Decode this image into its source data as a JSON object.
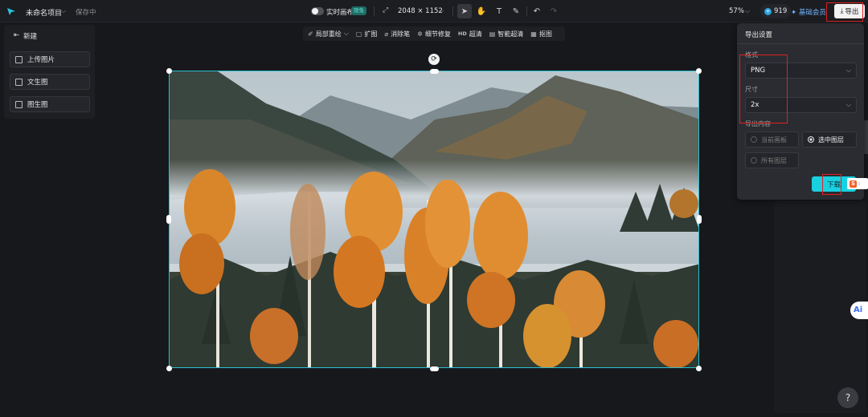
{
  "topbar": {
    "project_title": "未命名项目",
    "save_status": "保存中",
    "live_canvas_label": "实时画布",
    "live_canvas_badge": "限免",
    "canvas_size": "2048 × 1152",
    "zoom": "57%",
    "credits": "919",
    "vip_label": "基础会员",
    "export_label": "导出"
  },
  "left_panel": {
    "new_label": "新建",
    "items": [
      {
        "label": "上传图片",
        "icon": "upload-image-icon"
      },
      {
        "label": "文生图",
        "icon": "text-to-image-icon"
      },
      {
        "label": "图生图",
        "icon": "image-to-image-icon"
      }
    ]
  },
  "sub_toolbar": {
    "items": [
      {
        "label": "局部重绘",
        "glyph": "✐",
        "icon": "inpaint-icon"
      },
      {
        "label": "扩图",
        "glyph": "▢",
        "icon": "expand-icon"
      },
      {
        "label": "消除笔",
        "glyph": "⌀",
        "icon": "eraser-icon"
      },
      {
        "label": "细节修复",
        "glyph": "✲",
        "icon": "detail-fix-icon"
      },
      {
        "label": "超清",
        "glyph": "HD",
        "icon": "hd-icon"
      },
      {
        "label": "智能超清",
        "glyph": "▤",
        "icon": "smart-hd-icon"
      },
      {
        "label": "抠图",
        "glyph": "▦",
        "icon": "cutout-icon"
      }
    ]
  },
  "export_panel": {
    "title": "导出设置",
    "format_label": "格式",
    "format_value": "PNG",
    "size_label": "尺寸",
    "size_value": "2x",
    "content_label": "导出内容",
    "options": [
      {
        "label": "当前画板",
        "selected": false
      },
      {
        "label": "选中图层",
        "selected": true
      },
      {
        "label": "所有图层",
        "selected": false
      }
    ],
    "download_label": "下载"
  },
  "floating": {
    "ai_label": "Ai",
    "help_label": "?",
    "s_badge_label": "S"
  },
  "colors": {
    "accent": "#18d0e0",
    "selection_border": "#2bbfd1",
    "highlight_box": "#e02020",
    "vip": "#6fb6ff"
  }
}
